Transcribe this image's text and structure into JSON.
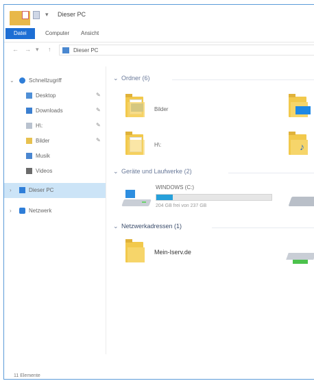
{
  "window": {
    "title": "Dieser PC"
  },
  "ribbon": {
    "tabs": [
      "Datei",
      "Computer",
      "Ansicht"
    ]
  },
  "address": {
    "path": "Dieser PC"
  },
  "sidebar": {
    "items": [
      {
        "label": "Schnellzugriff",
        "icon": "star-icon"
      },
      {
        "label": "Desktop",
        "icon": "desktop-icon"
      },
      {
        "label": "Downloads",
        "icon": "download-icon"
      },
      {
        "label": "H\\:",
        "icon": "drive-icon"
      },
      {
        "label": "Bilder",
        "icon": "pictures-icon"
      },
      {
        "label": "Musik",
        "icon": "music-icon"
      },
      {
        "label": "Videos",
        "icon": "video-icon"
      },
      {
        "label": "Dieser PC",
        "icon": "pc-icon"
      },
      {
        "label": "Netzwerk",
        "icon": "network-icon"
      }
    ]
  },
  "main": {
    "groups": [
      {
        "label": "Ordner",
        "count": "(6)"
      },
      {
        "label": "Geräte und Laufwerke",
        "count": "(2)"
      },
      {
        "label": "Netzwerkadressen",
        "count": "(1)"
      }
    ],
    "folders": [
      "Bilder",
      "H\\:"
    ],
    "drive": {
      "name": "WINDOWS (C:)",
      "usage_text": "204 GB frei von 237 GB",
      "used_fraction": 0.14
    },
    "network_location": "Mein-Iserv.de"
  },
  "status": {
    "text": "11 Elemente"
  },
  "colors": {
    "accent": "#1d6ed4",
    "selection": "#cce4f7",
    "progress": "#26a0da"
  }
}
